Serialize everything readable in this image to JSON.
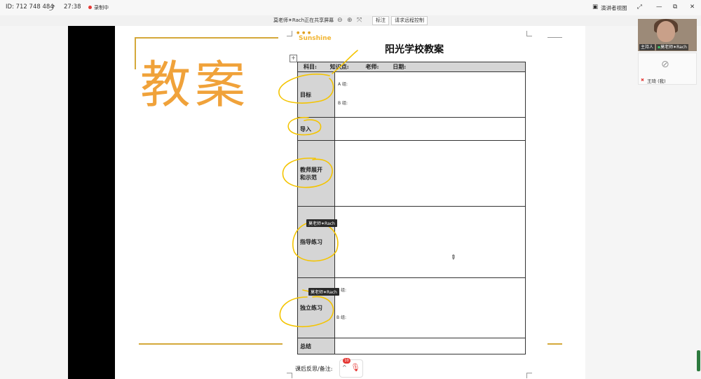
{
  "topbar": {
    "meeting_id": "ID: 712 748 484",
    "timer": "27:38",
    "recording": "录制中",
    "view_button": "演讲者视图",
    "minimize": "—",
    "restore": "⧉",
    "close": "✕"
  },
  "sharebar": {
    "message": "莫老师✶Rach正在共享屏幕",
    "annotate_button": "标注",
    "remote_control_button": "请求远程控制"
  },
  "document": {
    "big_title": "教案",
    "logo_text": "Sunshine",
    "logo_dots": "● ● ●",
    "plan_title": "阳光学校教案",
    "header": {
      "subject": "科目:",
      "knowledge": "知识点:",
      "teacher": "老师:",
      "date": "日期:"
    },
    "rows": [
      {
        "label": "目标",
        "a": "A 组:",
        "b": "B 组:"
      },
      {
        "label": "导入"
      },
      {
        "label_line1": "教师展开",
        "label_line2": "和示范"
      },
      {
        "label": "指导练习"
      },
      {
        "label": "独立练习",
        "a": "A 组:",
        "b": "B 组:"
      },
      {
        "label": "总结"
      }
    ],
    "footer_label": "课后反思/备注:",
    "mic_badge": "10",
    "annotator_tooltip": "莫老师✶Rach"
  },
  "participants": {
    "host_role": "主持人",
    "host_name": "莫老师✶Rach",
    "second_name": "王琦 (我)"
  },
  "colors": {
    "title_orange": "#f0a23a",
    "highlight_yellow": "#f4c400",
    "record_red": "#e53935"
  }
}
